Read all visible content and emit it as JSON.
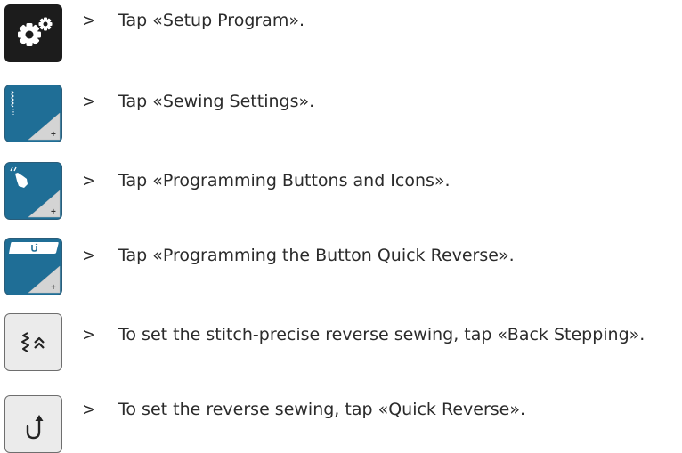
{
  "steps": [
    {
      "icon": "settings-gears-icon",
      "arrow": ">",
      "text": "Tap «Setup Program»."
    },
    {
      "icon": "sewing-settings-icon",
      "arrow": ">",
      "text": "Tap «Sewing Settings»."
    },
    {
      "icon": "programming-hand-icon",
      "arrow": ">",
      "text": "Tap «Programming Buttons and Icons»."
    },
    {
      "icon": "quick-reverse-button-icon",
      "arrow": ">",
      "text": "Tap «Programming the Button Quick Reverse»."
    },
    {
      "icon": "back-stepping-icon",
      "arrow": ">",
      "text": "To set the stitch-precise reverse sewing, tap «Back Stepping»."
    },
    {
      "icon": "quick-reverse-icon",
      "arrow": ">",
      "text": "To set the reverse sewing, tap «Quick Reverse»."
    }
  ],
  "colors": {
    "dark_button": "#1c1c1c",
    "blue_button": "#1f6e96",
    "gray_button": "#ebebeb"
  }
}
